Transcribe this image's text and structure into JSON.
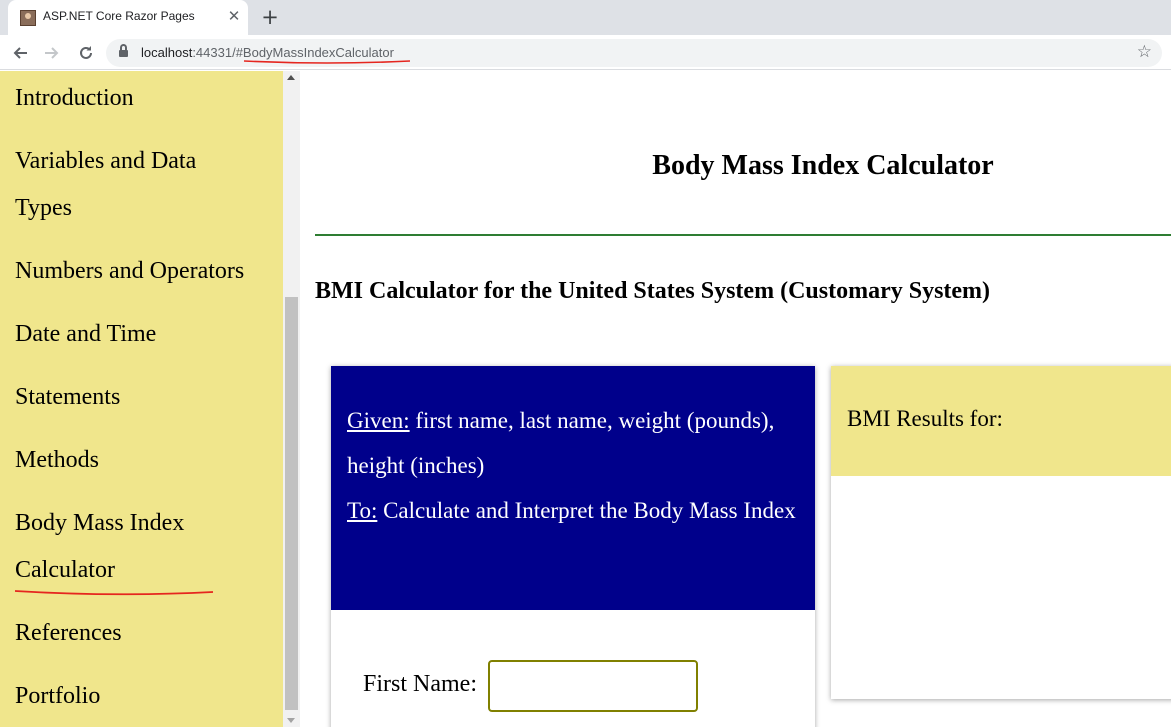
{
  "browser": {
    "tab_title": "ASP.NET Core Razor Pages",
    "tab_close": "✕",
    "new_tab": "+",
    "url_host": "localhost",
    "url_port": ":44331",
    "url_path": "/#BodyMassIndexCalculator"
  },
  "sidebar": {
    "items": [
      {
        "label": "Introduction"
      },
      {
        "label": "Variables and Data"
      },
      {
        "label": "Types"
      },
      {
        "label": "Numbers and Operators"
      },
      {
        "label": "Date and Time"
      },
      {
        "label": "Statements"
      },
      {
        "label": "Methods"
      },
      {
        "label": "Body Mass Index"
      },
      {
        "label": "Calculator"
      },
      {
        "label": "References"
      },
      {
        "label": "Portfolio"
      }
    ]
  },
  "main": {
    "title": "Body Mass Index Calculator",
    "section_heading": "BMI Calculator for the United States System (Customary System)",
    "given_label": "Given:",
    "given_text": " first name, last name, weight (pounds), height (inches)",
    "to_label": "To:",
    "to_text": " Calculate and Interpret the Body Mass Index",
    "first_name_label": "First Name:",
    "first_name_value": "",
    "results_label": "BMI Results for:"
  },
  "colors": {
    "sidebar_bg": "#f0e68c",
    "card_header_bg": "#00008b",
    "title_rule": "#2e7d32",
    "annotation_underline": "#e5261f",
    "input_border": "#808000"
  }
}
